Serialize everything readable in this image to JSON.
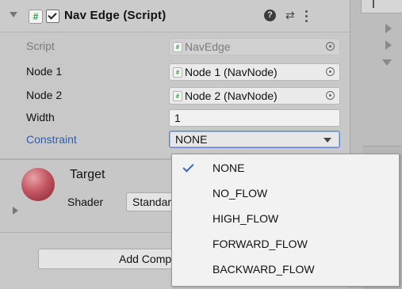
{
  "component": {
    "title": "Nav Edge (Script)",
    "enabled": true
  },
  "fields": {
    "script_label": "Script",
    "script_value": "NavEdge",
    "node1_label": "Node 1",
    "node1_value": "Node 1 (NavNode)",
    "node2_label": "Node 2",
    "node2_value": "Node 2 (NavNode)",
    "width_label": "Width",
    "width_value": "1",
    "constraint_label": "Constraint",
    "constraint_value": "NONE"
  },
  "material": {
    "name": "Target",
    "shader_label": "Shader",
    "shader_value": "Standard"
  },
  "add_component": {
    "label": "Add Component"
  },
  "constraint_menu": {
    "options": [
      "NONE",
      "NO_FLOW",
      "HIGH_FLOW",
      "FORWARD_FLOW",
      "BACKWARD_FLOW"
    ],
    "selected": "NONE"
  },
  "colors": {
    "accent": "#3569c3",
    "constraint_label": "#2f5eb0",
    "script_icon": "#2a9d3a"
  },
  "icons": [
    "fold-arrow-icon",
    "script-icon",
    "help-icon",
    "preset-icon",
    "kebab-menu-icon",
    "object-picker-icon",
    "dropdown-caret-icon",
    "checkmark-icon"
  ]
}
